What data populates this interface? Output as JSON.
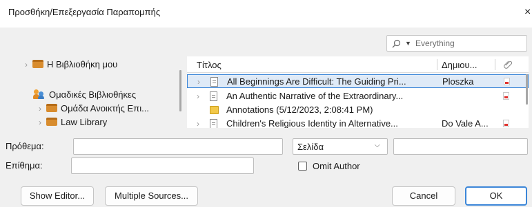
{
  "window": {
    "title": "Προσθήκη/Επεξεργασία Παραπομπής",
    "close_glyph": "×"
  },
  "search": {
    "icon": "search-icon",
    "dropdown_icon": "caret-down-icon",
    "scope": "Everything"
  },
  "collections": {
    "my_library": "Η Βιβλιοθήκη μου",
    "group_libraries_header": "Ομαδικές Βιβλιοθήκες",
    "groups": [
      "Ομάδα Ανοικτής Επι...",
      "Law Library"
    ],
    "folder_color": "#d88c2e"
  },
  "items": {
    "columns": {
      "title": "Τίτλος",
      "creator": "Δημιου...",
      "attachment_icon": "paperclip-icon"
    },
    "rows": [
      {
        "title": "All Beginnings Are Difficult: The Guiding Pri...",
        "creator": "Ploszka",
        "type": "document",
        "pdf": true,
        "selected": true
      },
      {
        "title": "An Authentic Narrative of the Extraordinary...",
        "creator": "",
        "type": "document",
        "pdf": true,
        "selected": false
      },
      {
        "title": "Annotations (5/12/2023, 2:08:41 PM)",
        "creator": "",
        "type": "note",
        "pdf": false,
        "selected": false
      },
      {
        "title": "Children's Religious Identity in Alternative...",
        "creator": "Do Vale A...",
        "type": "document",
        "pdf": true,
        "selected": false
      }
    ]
  },
  "form": {
    "prefix_label": "Πρόθεμα:",
    "prefix_value": "",
    "suffix_label": "Επίθημα:",
    "suffix_value": "",
    "locator_label": "Σελίδα",
    "locator_value": "",
    "omit_author_label": "Omit Author",
    "omit_author_checked": false
  },
  "buttons": {
    "show_editor": "Show Editor...",
    "multiple_sources": "Multiple Sources...",
    "cancel": "Cancel",
    "ok": "OK"
  },
  "colors": {
    "accent": "#3b86d8",
    "selection_bg": "#dfeaf7",
    "pdf_red": "#e0322e"
  }
}
